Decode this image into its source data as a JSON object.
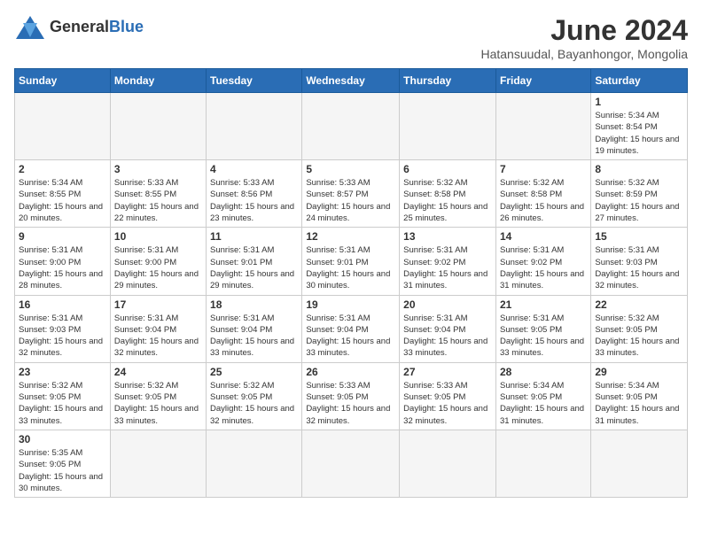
{
  "logo": {
    "general": "General",
    "blue": "Blue"
  },
  "title": "June 2024",
  "subtitle": "Hatansuudal, Bayanhongor, Mongolia",
  "days_of_week": [
    "Sunday",
    "Monday",
    "Tuesday",
    "Wednesday",
    "Thursday",
    "Friday",
    "Saturday"
  ],
  "weeks": [
    [
      {
        "day": "",
        "info": ""
      },
      {
        "day": "",
        "info": ""
      },
      {
        "day": "",
        "info": ""
      },
      {
        "day": "",
        "info": ""
      },
      {
        "day": "",
        "info": ""
      },
      {
        "day": "",
        "info": ""
      },
      {
        "day": "1",
        "info": "Sunrise: 5:34 AM\nSunset: 8:54 PM\nDaylight: 15 hours and 19 minutes."
      }
    ],
    [
      {
        "day": "2",
        "info": "Sunrise: 5:34 AM\nSunset: 8:55 PM\nDaylight: 15 hours and 20 minutes."
      },
      {
        "day": "3",
        "info": "Sunrise: 5:33 AM\nSunset: 8:55 PM\nDaylight: 15 hours and 22 minutes."
      },
      {
        "day": "4",
        "info": "Sunrise: 5:33 AM\nSunset: 8:56 PM\nDaylight: 15 hours and 23 minutes."
      },
      {
        "day": "5",
        "info": "Sunrise: 5:33 AM\nSunset: 8:57 PM\nDaylight: 15 hours and 24 minutes."
      },
      {
        "day": "6",
        "info": "Sunrise: 5:32 AM\nSunset: 8:58 PM\nDaylight: 15 hours and 25 minutes."
      },
      {
        "day": "7",
        "info": "Sunrise: 5:32 AM\nSunset: 8:58 PM\nDaylight: 15 hours and 26 minutes."
      },
      {
        "day": "8",
        "info": "Sunrise: 5:32 AM\nSunset: 8:59 PM\nDaylight: 15 hours and 27 minutes."
      }
    ],
    [
      {
        "day": "9",
        "info": "Sunrise: 5:31 AM\nSunset: 9:00 PM\nDaylight: 15 hours and 28 minutes."
      },
      {
        "day": "10",
        "info": "Sunrise: 5:31 AM\nSunset: 9:00 PM\nDaylight: 15 hours and 29 minutes."
      },
      {
        "day": "11",
        "info": "Sunrise: 5:31 AM\nSunset: 9:01 PM\nDaylight: 15 hours and 29 minutes."
      },
      {
        "day": "12",
        "info": "Sunrise: 5:31 AM\nSunset: 9:01 PM\nDaylight: 15 hours and 30 minutes."
      },
      {
        "day": "13",
        "info": "Sunrise: 5:31 AM\nSunset: 9:02 PM\nDaylight: 15 hours and 31 minutes."
      },
      {
        "day": "14",
        "info": "Sunrise: 5:31 AM\nSunset: 9:02 PM\nDaylight: 15 hours and 31 minutes."
      },
      {
        "day": "15",
        "info": "Sunrise: 5:31 AM\nSunset: 9:03 PM\nDaylight: 15 hours and 32 minutes."
      }
    ],
    [
      {
        "day": "16",
        "info": "Sunrise: 5:31 AM\nSunset: 9:03 PM\nDaylight: 15 hours and 32 minutes."
      },
      {
        "day": "17",
        "info": "Sunrise: 5:31 AM\nSunset: 9:04 PM\nDaylight: 15 hours and 32 minutes."
      },
      {
        "day": "18",
        "info": "Sunrise: 5:31 AM\nSunset: 9:04 PM\nDaylight: 15 hours and 33 minutes."
      },
      {
        "day": "19",
        "info": "Sunrise: 5:31 AM\nSunset: 9:04 PM\nDaylight: 15 hours and 33 minutes."
      },
      {
        "day": "20",
        "info": "Sunrise: 5:31 AM\nSunset: 9:04 PM\nDaylight: 15 hours and 33 minutes."
      },
      {
        "day": "21",
        "info": "Sunrise: 5:31 AM\nSunset: 9:05 PM\nDaylight: 15 hours and 33 minutes."
      },
      {
        "day": "22",
        "info": "Sunrise: 5:32 AM\nSunset: 9:05 PM\nDaylight: 15 hours and 33 minutes."
      }
    ],
    [
      {
        "day": "23",
        "info": "Sunrise: 5:32 AM\nSunset: 9:05 PM\nDaylight: 15 hours and 33 minutes."
      },
      {
        "day": "24",
        "info": "Sunrise: 5:32 AM\nSunset: 9:05 PM\nDaylight: 15 hours and 33 minutes."
      },
      {
        "day": "25",
        "info": "Sunrise: 5:32 AM\nSunset: 9:05 PM\nDaylight: 15 hours and 32 minutes."
      },
      {
        "day": "26",
        "info": "Sunrise: 5:33 AM\nSunset: 9:05 PM\nDaylight: 15 hours and 32 minutes."
      },
      {
        "day": "27",
        "info": "Sunrise: 5:33 AM\nSunset: 9:05 PM\nDaylight: 15 hours and 32 minutes."
      },
      {
        "day": "28",
        "info": "Sunrise: 5:34 AM\nSunset: 9:05 PM\nDaylight: 15 hours and 31 minutes."
      },
      {
        "day": "29",
        "info": "Sunrise: 5:34 AM\nSunset: 9:05 PM\nDaylight: 15 hours and 31 minutes."
      }
    ],
    [
      {
        "day": "30",
        "info": "Sunrise: 5:35 AM\nSunset: 9:05 PM\nDaylight: 15 hours and 30 minutes."
      },
      {
        "day": "",
        "info": ""
      },
      {
        "day": "",
        "info": ""
      },
      {
        "day": "",
        "info": ""
      },
      {
        "day": "",
        "info": ""
      },
      {
        "day": "",
        "info": ""
      },
      {
        "day": "",
        "info": ""
      }
    ]
  ]
}
